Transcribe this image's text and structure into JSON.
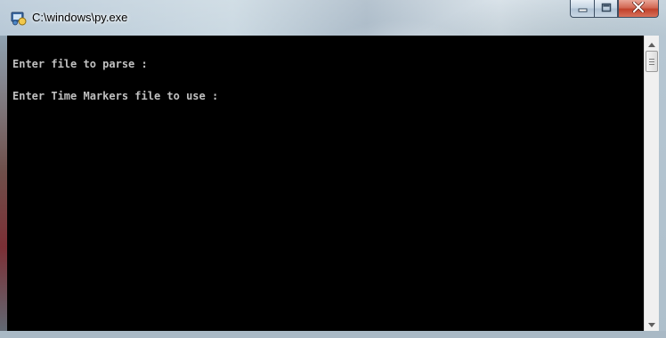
{
  "window": {
    "title": "C:\\windows\\py.exe",
    "icon": "python-launcher-icon",
    "buttons": {
      "minimize_icon": "minimize-icon",
      "maximize_icon": "maximize-icon",
      "close_icon": "close-icon"
    },
    "colors": {
      "console_background": "#000000",
      "console_text": "#c0c0c0",
      "close_button": "#c1412a"
    }
  },
  "console": {
    "lines": [
      "Enter file to parse :",
      "Enter Time Markers file to use :"
    ]
  }
}
